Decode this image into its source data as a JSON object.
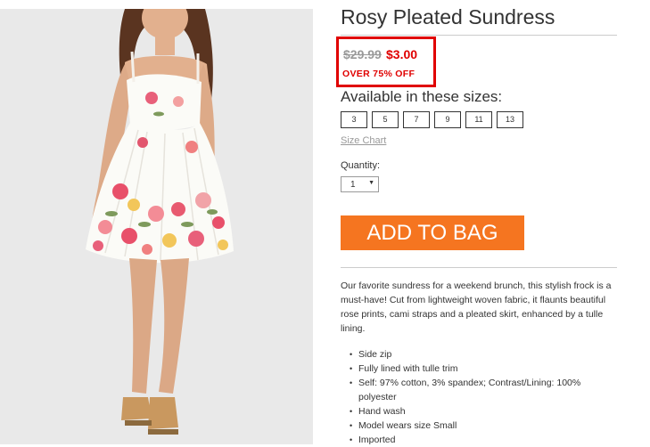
{
  "product": {
    "title": "Rosy Pleated Sundress",
    "image_alt": "model-wearing-rosy-pleated-sundress"
  },
  "price": {
    "original": "$29.99",
    "sale": "$3.00",
    "discount_text": "OVER 75% OFF",
    "highlight_color": "#e00000"
  },
  "sizes": {
    "heading": "Available in these sizes:",
    "options": [
      "3",
      "5",
      "7",
      "9",
      "11",
      "13"
    ],
    "size_chart_link": "Size Chart"
  },
  "quantity": {
    "label": "Quantity:",
    "selected": "1"
  },
  "cta": {
    "add_to_bag_label": "ADD TO BAG",
    "color": "#f57520"
  },
  "description": {
    "text": "Our favorite sundress for a weekend brunch, this stylish frock is a must-have! Cut from lightweight woven fabric, it flaunts beautiful rose prints, cami straps and a pleated skirt, enhanced by a tulle lining.",
    "features": [
      "Side zip",
      "Fully lined with tulle trim",
      "Self: 97% cotton, 3% spandex; Contrast/Lining: 100% polyester",
      "Hand wash",
      "Model wears size Small",
      "Imported"
    ]
  }
}
